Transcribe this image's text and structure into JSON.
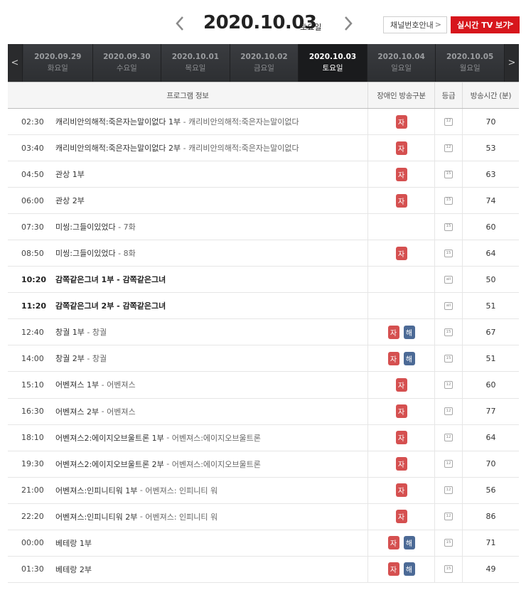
{
  "header": {
    "date": "2020.10.03",
    "weekday": "토요일",
    "channel_button": "채널번호안내",
    "live_button": "실시간 TV 보기"
  },
  "date_tabs": [
    {
      "date": "2020.09.29",
      "day": "화요일",
      "active": false
    },
    {
      "date": "2020.09.30",
      "day": "수요일",
      "active": false
    },
    {
      "date": "2020.10.01",
      "day": "목요일",
      "active": false
    },
    {
      "date": "2020.10.02",
      "day": "금요일",
      "active": false
    },
    {
      "date": "2020.10.03",
      "day": "토요일",
      "active": true
    },
    {
      "date": "2020.10.04",
      "day": "일요일",
      "active": false
    },
    {
      "date": "2020.10.05",
      "day": "월요일",
      "active": false
    }
  ],
  "table": {
    "headers": {
      "info": "프로그램 정보",
      "disability": "장애인 방송구분",
      "grade": "등급",
      "duration": "방송시간 (분)"
    },
    "badge_labels": {
      "ja": "자",
      "hae": "해"
    },
    "rows": [
      {
        "time": "02:30",
        "title": "캐리비안의해적:죽은자는말이없다 1부",
        "sub": "캐리비안의해적:죽은자는말이없다",
        "badges": [
          "ja"
        ],
        "grade": "12",
        "duration": "70",
        "bold": false
      },
      {
        "time": "03:40",
        "title": "캐리비안의해적:죽은자는말이없다 2부",
        "sub": "캐리비안의해적:죽은자는말이없다",
        "badges": [
          "ja"
        ],
        "grade": "12",
        "duration": "53",
        "bold": false
      },
      {
        "time": "04:50",
        "title": "관상 1부",
        "sub": "",
        "badges": [
          "ja"
        ],
        "grade": "15",
        "duration": "63",
        "bold": false
      },
      {
        "time": "06:00",
        "title": "관상 2부",
        "sub": "",
        "badges": [
          "ja"
        ],
        "grade": "15",
        "duration": "74",
        "bold": false
      },
      {
        "time": "07:30",
        "title": "미씽:그들이있었다",
        "sub": "7화",
        "badges": [],
        "grade": "15",
        "duration": "60",
        "bold": false
      },
      {
        "time": "08:50",
        "title": "미씽:그들이있었다",
        "sub": "8화",
        "badges": [
          "ja"
        ],
        "grade": "15",
        "duration": "64",
        "bold": false
      },
      {
        "time": "10:20",
        "title": "감쪽같은그녀 1부",
        "sub": "감쪽같은그녀",
        "badges": [],
        "grade": "all",
        "duration": "50",
        "bold": true
      },
      {
        "time": "11:20",
        "title": "감쪽같은그녀 2부",
        "sub": "감쪽같은그녀",
        "badges": [],
        "grade": "all",
        "duration": "51",
        "bold": true
      },
      {
        "time": "12:40",
        "title": "창궐 1부",
        "sub": "창궐",
        "badges": [
          "ja",
          "hae"
        ],
        "grade": "15",
        "duration": "67",
        "bold": false
      },
      {
        "time": "14:00",
        "title": "창궐 2부",
        "sub": "창궐",
        "badges": [
          "ja",
          "hae"
        ],
        "grade": "15",
        "duration": "51",
        "bold": false
      },
      {
        "time": "15:10",
        "title": "어벤져스 1부",
        "sub": "어벤져스",
        "badges": [
          "ja"
        ],
        "grade": "12",
        "duration": "60",
        "bold": false
      },
      {
        "time": "16:30",
        "title": "어벤져스 2부",
        "sub": "어벤져스",
        "badges": [
          "ja"
        ],
        "grade": "12",
        "duration": "77",
        "bold": false
      },
      {
        "time": "18:10",
        "title": "어벤져스2:에이지오브울트론 1부",
        "sub": "어벤져스:에이지오브울트론",
        "badges": [
          "ja"
        ],
        "grade": "12",
        "duration": "64",
        "bold": false
      },
      {
        "time": "19:30",
        "title": "어벤져스2:에이지오브울트론 2부",
        "sub": "어벤져스:에이지오브울트론",
        "badges": [
          "ja"
        ],
        "grade": "12",
        "duration": "70",
        "bold": false
      },
      {
        "time": "21:00",
        "title": "어벤져스:인피니티워 1부",
        "sub": "어벤져스: 인피니티 워",
        "badges": [
          "ja"
        ],
        "grade": "12",
        "duration": "56",
        "bold": false
      },
      {
        "time": "22:20",
        "title": "어벤져스:인피니티워 2부",
        "sub": "어벤져스: 인피니티 워",
        "badges": [
          "ja"
        ],
        "grade": "12",
        "duration": "86",
        "bold": false
      },
      {
        "time": "00:00",
        "title": "베테랑 1부",
        "sub": "",
        "badges": [
          "ja",
          "hae"
        ],
        "grade": "15",
        "duration": "71",
        "bold": false
      },
      {
        "time": "01:30",
        "title": "베테랑 2부",
        "sub": "",
        "badges": [
          "ja",
          "hae"
        ],
        "grade": "15",
        "duration": "49",
        "bold": false
      }
    ]
  },
  "colors": {
    "live_red": "#d7161c",
    "badge_ja": "#d55050",
    "badge_hae": "#4c6a96",
    "strip_dark": "#2e3033"
  }
}
